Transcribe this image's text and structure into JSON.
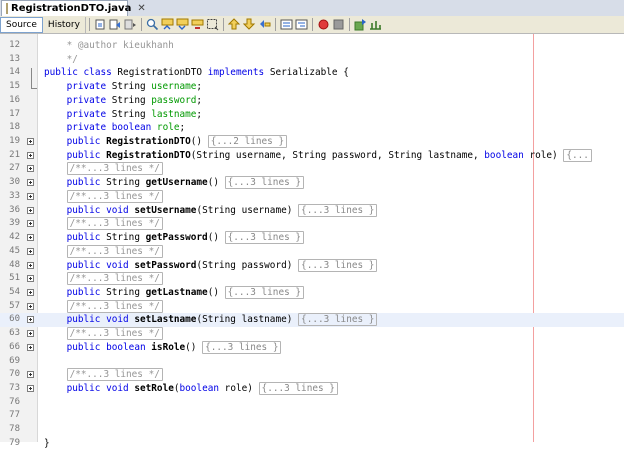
{
  "file_tab": {
    "label": "RegistrationDTO.java",
    "close": "✕"
  },
  "toolbar": {
    "source_label": "Source",
    "history_label": "History",
    "icons": [
      "last-edit-icon",
      "back-icon",
      "forward-icon",
      "find-selection-icon",
      "find-previous-icon",
      "find-next-icon",
      "toggle-highlight-icon",
      "toggle-rectangular-icon",
      "shift-left-icon",
      "shift-right-icon",
      "comment-icon",
      "uncomment-icon",
      "start-macro-icon",
      "stop-macro-icon",
      "previous-diff-icon",
      "next-diff-icon"
    ]
  },
  "editor": {
    "highlighted_line": "60",
    "lines": [
      {
        "num": "12",
        "fold": false,
        "html": "   <span class=\"cm\"> * @author kieukhanh</span>"
      },
      {
        "num": "13",
        "fold": false,
        "html": "   <span class=\"cm\"> */</span>"
      },
      {
        "num": "14",
        "fold": false,
        "html": "<span class=\"kw\">public</span> <span class=\"kw\">class</span> RegistrationDTO <span class=\"kw\">implements</span> Serializable {"
      },
      {
        "num": "15",
        "fold": false,
        "html": "    <span class=\"kw\">private</span> String <span class=\"fld\">username</span>;"
      },
      {
        "num": "16",
        "fold": false,
        "html": "    <span class=\"kw\">private</span> String <span class=\"fld\">password</span>;"
      },
      {
        "num": "17",
        "fold": false,
        "html": "    <span class=\"kw\">private</span> String <span class=\"fld\">lastname</span>;"
      },
      {
        "num": "18",
        "fold": false,
        "html": "    <span class=\"kw\">private</span> <span class=\"kw\">boolean</span> <span class=\"fld\">role</span>;"
      },
      {
        "num": "19",
        "fold": true,
        "html": "    <span class=\"kw\">public</span> <span class=\"bold\">RegistrationDTO</span>() <span class=\"fb\">{...2 lines }</span>"
      },
      {
        "num": "21",
        "fold": true,
        "html": "    <span class=\"kw\">public</span> <span class=\"bold\">RegistrationDTO</span>(String username, String password, String lastname, <span class=\"kw\">boolean</span> role) <span class=\"fb\">{...</span>"
      },
      {
        "num": "27",
        "fold": true,
        "html": "    <span class=\"fb\"><span class=\"cm\">/**...3 lines */</span></span>"
      },
      {
        "num": "30",
        "fold": true,
        "html": "    <span class=\"kw\">public</span> String <span class=\"bold\">getUsername</span>() <span class=\"fb\">{...3 lines }</span>"
      },
      {
        "num": "33",
        "fold": true,
        "html": "    <span class=\"fb\"><span class=\"cm\">/**...3 lines */</span></span>"
      },
      {
        "num": "36",
        "fold": true,
        "html": "    <span class=\"kw\">public</span> <span class=\"kw\">void</span> <span class=\"bold\">setUsername</span>(String username) <span class=\"fb\">{...3 lines }</span>"
      },
      {
        "num": "39",
        "fold": true,
        "html": "    <span class=\"fb\"><span class=\"cm\">/**...3 lines */</span></span>"
      },
      {
        "num": "42",
        "fold": true,
        "html": "    <span class=\"kw\">public</span> String <span class=\"bold\">getPassword</span>() <span class=\"fb\">{...3 lines }</span>"
      },
      {
        "num": "45",
        "fold": true,
        "html": "    <span class=\"fb\"><span class=\"cm\">/**...3 lines */</span></span>"
      },
      {
        "num": "48",
        "fold": true,
        "html": "    <span class=\"kw\">public</span> <span class=\"kw\">void</span> <span class=\"bold\">setPassword</span>(String password) <span class=\"fb\">{...3 lines }</span>"
      },
      {
        "num": "51",
        "fold": true,
        "html": "    <span class=\"fb\"><span class=\"cm\">/**...3 lines */</span></span>"
      },
      {
        "num": "54",
        "fold": true,
        "html": "    <span class=\"kw\">public</span> String <span class=\"bold\">getLastname</span>() <span class=\"fb\">{...3 lines }</span>"
      },
      {
        "num": "57",
        "fold": true,
        "html": "    <span class=\"fb\"><span class=\"cm\">/**...3 lines */</span></span>"
      },
      {
        "num": "60",
        "fold": true,
        "html": "    <span class=\"kw\">public</span> <span class=\"kw\">void</span> <span class=\"bold\">setLastname</span>(String lastname) <span class=\"fb\">{...3 lines }</span>"
      },
      {
        "num": "63",
        "fold": true,
        "html": "    <span class=\"fb\"><span class=\"cm\">/**...3 lines */</span></span>"
      },
      {
        "num": "66",
        "fold": true,
        "html": "    <span class=\"kw\">public</span> <span class=\"kw\">boolean</span> <span class=\"bold\">isRole</span>() <span class=\"fb\">{...3 lines }</span>"
      },
      {
        "num": "69",
        "fold": false,
        "html": ""
      },
      {
        "num": "70",
        "fold": true,
        "html": "    <span class=\"fb\"><span class=\"cm\">/**...3 lines */</span></span>"
      },
      {
        "num": "73",
        "fold": true,
        "html": "    <span class=\"kw\">public</span> <span class=\"kw\">void</span> <span class=\"bold\">setRole</span>(<span class=\"kw\">boolean</span> role) <span class=\"fb\">{...3 lines }</span>"
      },
      {
        "num": "76",
        "fold": false,
        "html": ""
      },
      {
        "num": "77",
        "fold": false,
        "html": ""
      },
      {
        "num": "78",
        "fold": false,
        "html": ""
      },
      {
        "num": "79",
        "fold": false,
        "html": "}"
      }
    ]
  }
}
